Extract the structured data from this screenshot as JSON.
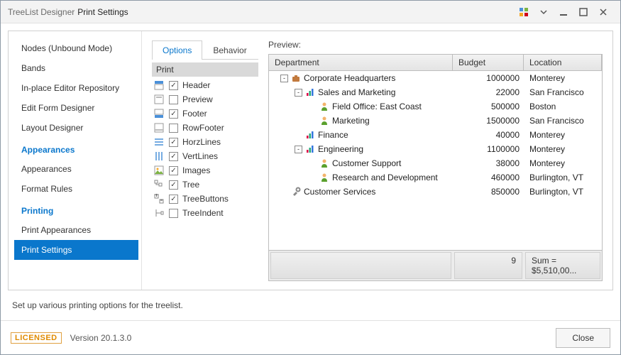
{
  "window": {
    "title_a": "TreeList Designer",
    "title_b": "Print Settings"
  },
  "sidebar": {
    "groups": [
      {
        "head": null,
        "items": [
          "Nodes (Unbound Mode)",
          "Bands",
          "In-place Editor Repository",
          "Edit Form Designer",
          "Layout Designer"
        ]
      },
      {
        "head": "Appearances",
        "items": [
          "Appearances",
          "Format Rules"
        ]
      },
      {
        "head": "Printing",
        "items": [
          "Print Appearances",
          "Print Settings"
        ]
      }
    ],
    "selected": "Print Settings"
  },
  "tabs": {
    "items": [
      "Options",
      "Behavior"
    ],
    "selected": "Options"
  },
  "options_group": "Print",
  "options": [
    {
      "icon": "header",
      "checked": true,
      "label": "Header"
    },
    {
      "icon": "preview",
      "checked": false,
      "label": "Preview"
    },
    {
      "icon": "footer",
      "checked": true,
      "label": "Footer"
    },
    {
      "icon": "rowfoot",
      "checked": false,
      "label": "RowFooter"
    },
    {
      "icon": "hlines",
      "checked": true,
      "label": "HorzLines"
    },
    {
      "icon": "vlines",
      "checked": true,
      "label": "VertLines"
    },
    {
      "icon": "images",
      "checked": true,
      "label": "Images"
    },
    {
      "icon": "tree",
      "checked": true,
      "label": "Tree"
    },
    {
      "icon": "treebtn",
      "checked": true,
      "label": "TreeButtons"
    },
    {
      "icon": "indent",
      "checked": false,
      "label": "TreeIndent"
    }
  ],
  "preview_label": "Preview:",
  "grid": {
    "columns": [
      "Department",
      "Budget",
      "Location"
    ],
    "rows": [
      {
        "depth": 0,
        "exp": "-",
        "icon": "briefcase",
        "dept": "Corporate Headquarters",
        "budget": "1000000",
        "loc": "Monterey"
      },
      {
        "depth": 1,
        "exp": "-",
        "icon": "chart",
        "dept": "Sales and Marketing",
        "budget": "22000",
        "loc": "San Francisco"
      },
      {
        "depth": 2,
        "exp": "",
        "icon": "person",
        "dept": "Field Office: East Coast",
        "budget": "500000",
        "loc": "Boston"
      },
      {
        "depth": 2,
        "exp": "",
        "icon": "person",
        "dept": "Marketing",
        "budget": "1500000",
        "loc": "San Francisco"
      },
      {
        "depth": 1,
        "exp": "",
        "icon": "chart",
        "dept": "Finance",
        "budget": "40000",
        "loc": "Monterey"
      },
      {
        "depth": 1,
        "exp": "-",
        "icon": "chart",
        "dept": "Engineering",
        "budget": "1100000",
        "loc": "Monterey"
      },
      {
        "depth": 2,
        "exp": "",
        "icon": "person",
        "dept": "Customer Support",
        "budget": "38000",
        "loc": "Monterey"
      },
      {
        "depth": 2,
        "exp": "",
        "icon": "person",
        "dept": "Research and Development",
        "budget": "460000",
        "loc": "Burlington, VT"
      },
      {
        "depth": 0,
        "exp": "",
        "icon": "tools",
        "dept": "Customer Services",
        "budget": "850000",
        "loc": "Burlington, VT"
      }
    ],
    "footer": {
      "dept": "",
      "budget": "9",
      "loc": "Sum = $5,510,00..."
    }
  },
  "description": "Set up various printing options for the treelist.",
  "footer": {
    "licensed": "LICENSED",
    "version": "Version 20.1.3.0",
    "close": "Close"
  }
}
